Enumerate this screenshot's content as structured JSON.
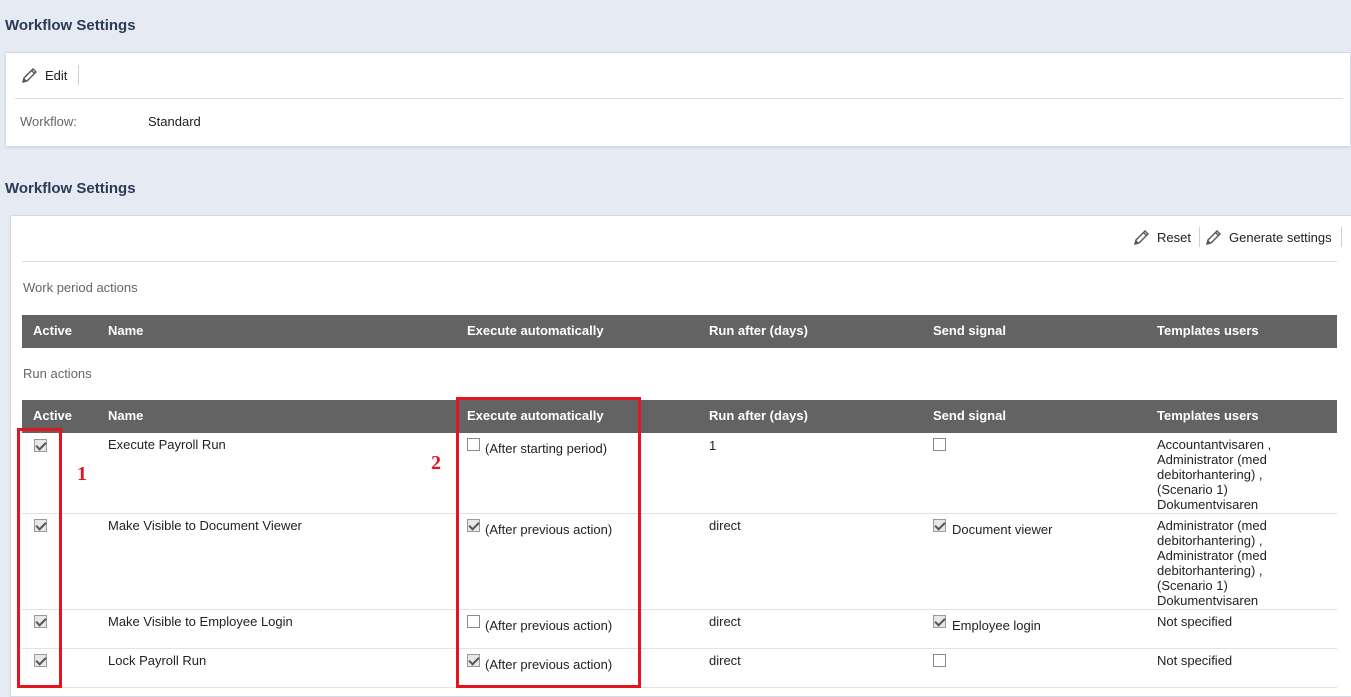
{
  "top_section": {
    "title": "Workflow Settings",
    "edit_label": "Edit",
    "workflow_label": "Workflow:",
    "workflow_value": "Standard"
  },
  "settings_section": {
    "title": "Workflow Settings",
    "reset_label": "Reset",
    "generate_label": "Generate settings",
    "work_period_heading": "Work period actions",
    "run_actions_heading": "Run actions",
    "columns": {
      "active": "Active",
      "name": "Name",
      "execute": "Execute automatically",
      "run_after": "Run after (days)",
      "send_signal": "Send signal",
      "templates": "Templates users"
    },
    "rows": [
      {
        "active": true,
        "name": "Execute Payroll Run",
        "execute_checked": false,
        "execute_label": "(After starting period)",
        "run_after": "1",
        "signal_checked": false,
        "signal_label": "",
        "templates": [
          "Accountantvisaren ,",
          "Administrator (med",
          "debitorhantering) ,",
          "(Scenario 1)",
          "Dokumentvisaren"
        ]
      },
      {
        "active": true,
        "name": "Make Visible to Document Viewer",
        "execute_checked": true,
        "execute_label": "(After previous action)",
        "run_after": "direct",
        "signal_checked": true,
        "signal_label": "Document viewer",
        "templates": [
          "Administrator (med",
          "debitorhantering) ,",
          "Administrator (med",
          "debitorhantering) ,",
          "(Scenario 1)",
          "Dokumentvisaren"
        ]
      },
      {
        "active": true,
        "name": "Make Visible to Employee Login",
        "execute_checked": false,
        "execute_label": "(After previous action)",
        "run_after": "direct",
        "signal_checked": true,
        "signal_label": "Employee login",
        "templates": [
          "Not specified"
        ]
      },
      {
        "active": true,
        "name": "Lock Payroll Run",
        "execute_checked": true,
        "execute_label": "(After previous action)",
        "run_after": "direct",
        "signal_checked": false,
        "signal_label": "",
        "templates": [
          "Not specified"
        ]
      }
    ]
  },
  "annotations": {
    "marker_1": "1",
    "marker_2": "2",
    "color": "#e3161f"
  },
  "icons": {
    "edit": "pencil-icon",
    "reset": "pencil-icon",
    "generate": "pencil-icon"
  }
}
